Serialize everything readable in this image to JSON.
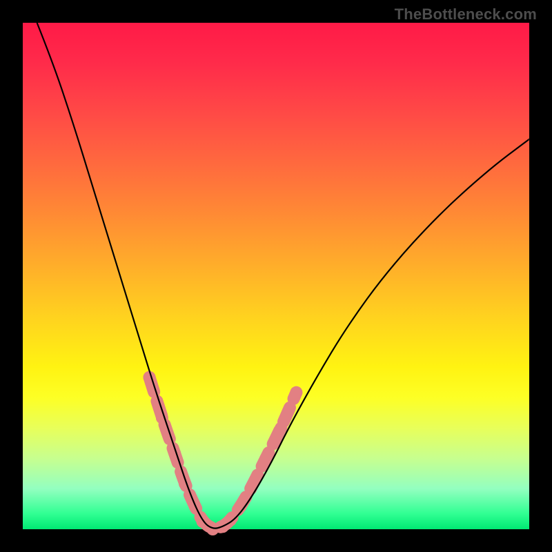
{
  "watermark": "TheBottleneck.com",
  "chart_data": {
    "type": "line",
    "title": "",
    "xlabel": "",
    "ylabel": "",
    "xlim": [
      0,
      1
    ],
    "ylim": [
      0,
      1
    ],
    "series": [
      {
        "name": "bottleneck-curve",
        "x": [
          0.028,
          0.06,
          0.1,
          0.14,
          0.18,
          0.22,
          0.26,
          0.3,
          0.33,
          0.355,
          0.375,
          0.395,
          0.42,
          0.45,
          0.49,
          0.53,
          0.58,
          0.64,
          0.72,
          0.82,
          0.92,
          1.0
        ],
        "y": [
          1.0,
          0.92,
          0.8,
          0.67,
          0.54,
          0.41,
          0.28,
          0.16,
          0.07,
          0.015,
          0.0,
          0.005,
          0.02,
          0.06,
          0.13,
          0.21,
          0.3,
          0.4,
          0.51,
          0.62,
          0.71,
          0.77
        ]
      }
    ],
    "highlighted_region": {
      "name": "good-match-band",
      "color": "#e28083",
      "x": [
        0.25,
        0.275,
        0.3,
        0.32,
        0.34,
        0.355,
        0.375,
        0.395,
        0.41,
        0.43,
        0.45,
        0.48,
        0.51,
        0.54
      ],
      "y": [
        0.3,
        0.22,
        0.15,
        0.09,
        0.045,
        0.015,
        0.0,
        0.005,
        0.018,
        0.045,
        0.08,
        0.14,
        0.2,
        0.27
      ]
    },
    "background_gradient": {
      "top_color": "#ff1a47",
      "mid_color": "#fff312",
      "bottom_color": "#00e873"
    }
  }
}
